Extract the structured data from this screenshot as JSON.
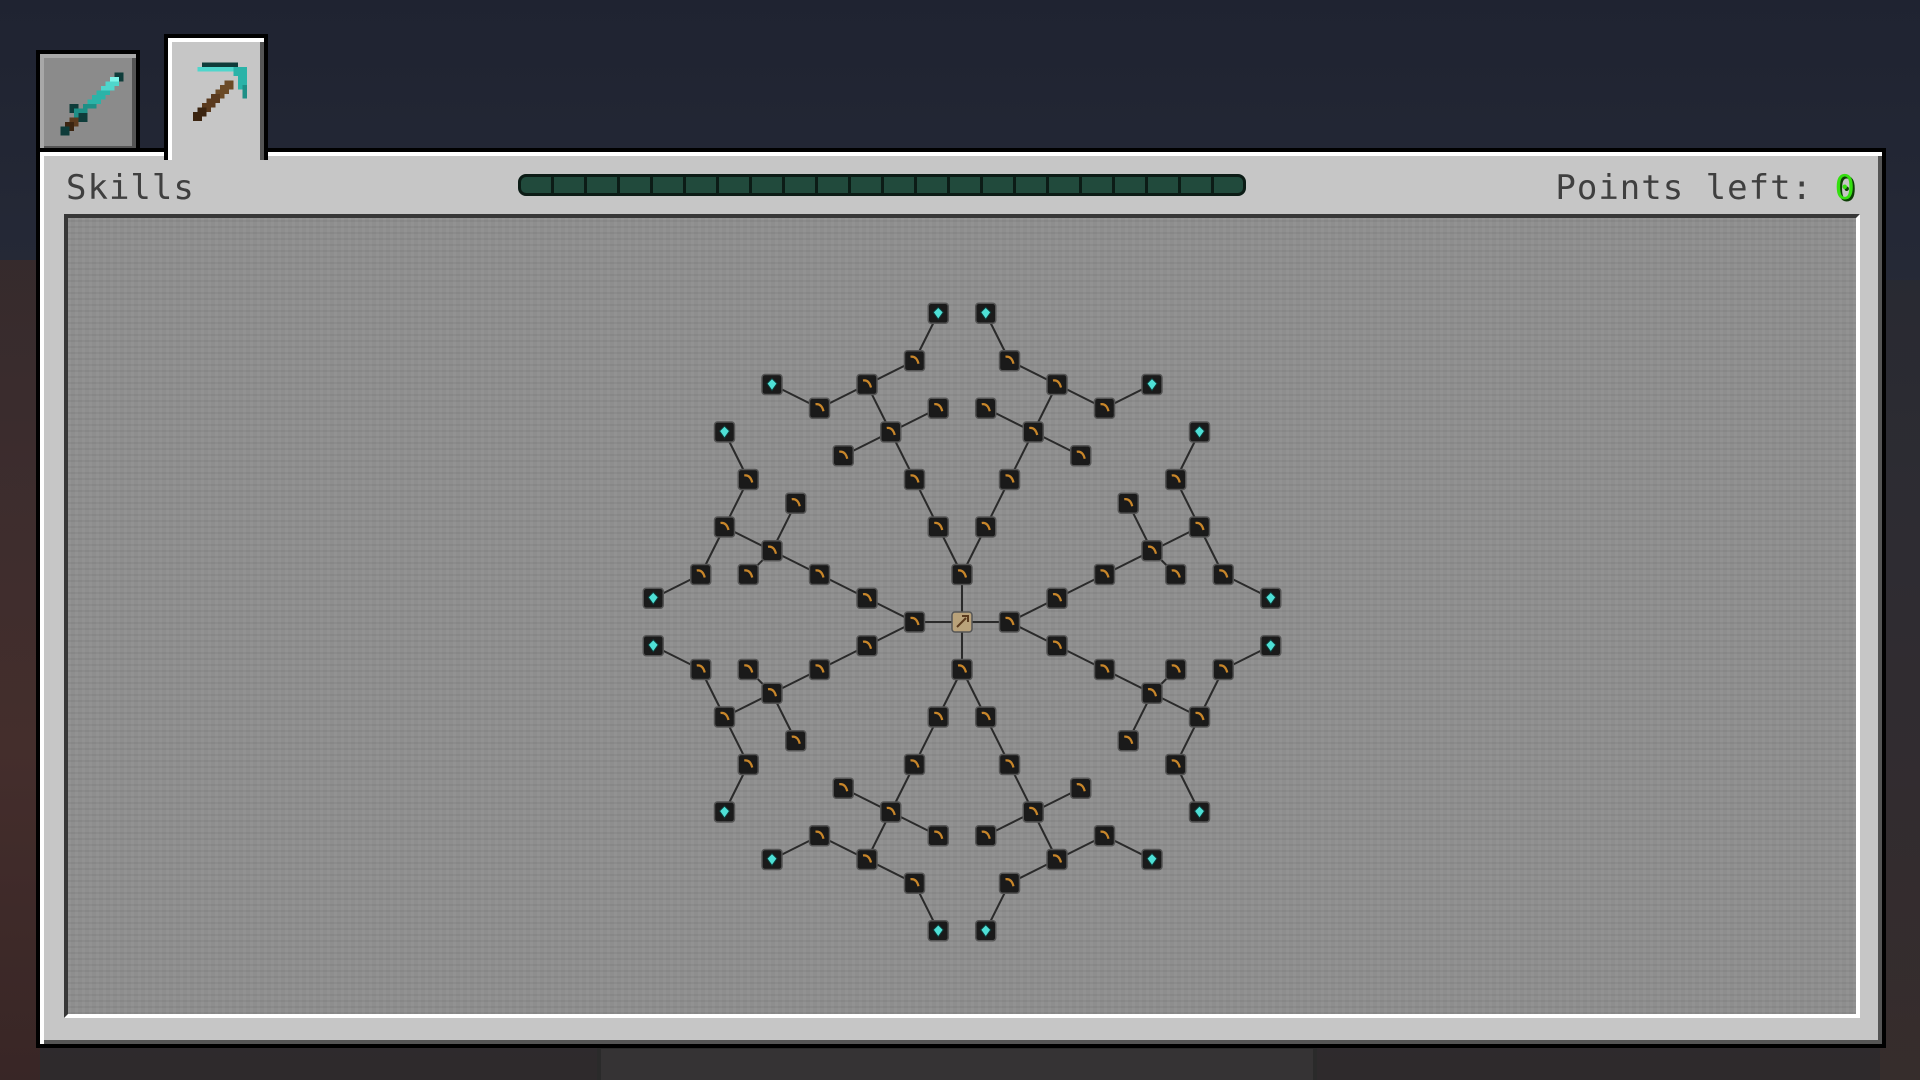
{
  "screen": {
    "title": "Skills"
  },
  "tabs": [
    {
      "label": "sword",
      "icon": "diamond-sword-icon",
      "selected": false
    },
    {
      "label": "pickaxe",
      "icon": "diamond-pickaxe-icon",
      "selected": true
    }
  ],
  "points": {
    "label": "Points left:",
    "value": "0"
  },
  "progress": {
    "fraction": 0.0
  },
  "colors": {
    "panel": "#c6c6c6",
    "tree_background": "#8e8e8e",
    "edge": "#2a2a2a",
    "skill_node": "#1a1a1a",
    "skill_icon": "#c8862a",
    "leaf_icon": "#4fe0d6",
    "points_value": "#34e00f"
  },
  "skill_tree": {
    "root": {
      "icon": "pickaxe-icon"
    },
    "node_icon": "pickaxe-head-icon",
    "leaf_icon": "diamond-gem-icon",
    "node_count": 97,
    "leaf_count": 24
  }
}
